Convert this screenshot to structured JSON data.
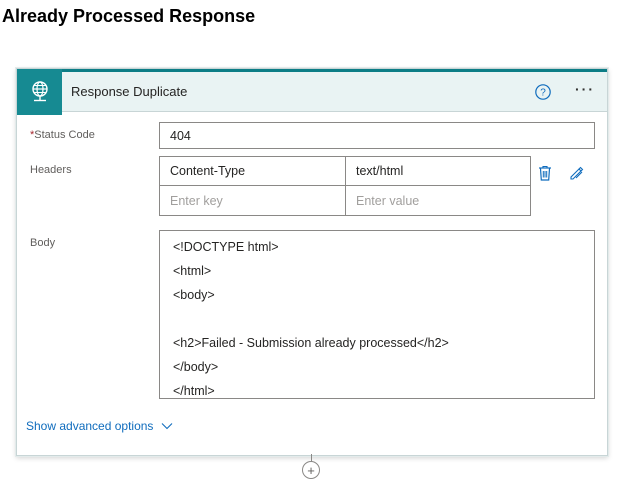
{
  "page": {
    "title": "Already Processed Response"
  },
  "card": {
    "title": "Response Duplicate",
    "icon": "globe-network-icon",
    "accent_color": "#168a92",
    "header_bg": "#e9f3f3",
    "actions": {
      "help_icon": "question-circle-icon",
      "more_icon": "ellipsis-icon"
    }
  },
  "fields": {
    "status_code": {
      "required_marker": "*",
      "label": "Status Code",
      "value": "404"
    },
    "headers": {
      "label": "Headers",
      "rows": [
        {
          "key": "Content-Type",
          "value": "text/html"
        }
      ],
      "new_row": {
        "key_placeholder": "Enter key",
        "value_placeholder": "Enter value"
      },
      "delete_icon": "trash-icon",
      "switch_mode_icon": "text-mode-icon"
    },
    "body": {
      "label": "Body",
      "lines": [
        "<!DOCTYPE html>",
        "<html>",
        "<body>",
        "",
        "<h2>Failed - Submission already processed</h2>",
        "</body>",
        "</html>"
      ]
    }
  },
  "advanced_options": {
    "label": "Show advanced options",
    "icon": "chevron-down-icon",
    "color": "#0f6cbd"
  },
  "add_step": {
    "icon": "plus-icon"
  }
}
